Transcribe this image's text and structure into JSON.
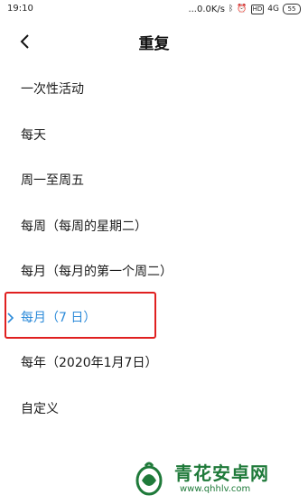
{
  "status_bar": {
    "time": "19:10",
    "network_speed": "...0.0K/s",
    "bluetooth_icon": "ᛒ",
    "alarm_icon": "⏰",
    "hd_badge": "HD",
    "signal_badge": "4G",
    "battery_level": "55"
  },
  "header": {
    "title": "重复",
    "back_icon": "chevron-left-icon"
  },
  "repeat_options": [
    {
      "label": "一次性活动",
      "selected": false
    },
    {
      "label": "每天",
      "selected": false
    },
    {
      "label": "周一至周五",
      "selected": false
    },
    {
      "label": "每周（每周的星期二）",
      "selected": false
    },
    {
      "label": "每月（每月的第一个周二）",
      "selected": false
    },
    {
      "label": "每月（7 日）",
      "selected": true
    },
    {
      "label": "每年（2020年1月7日）",
      "selected": false
    },
    {
      "label": "自定义",
      "selected": false
    }
  ],
  "colors": {
    "accent": "#2b8ad9",
    "highlight_border": "#e02020",
    "watermark": "#1f7a3a"
  },
  "watermark": {
    "name": "青花安卓网",
    "url": "www.qhhlv.com"
  }
}
